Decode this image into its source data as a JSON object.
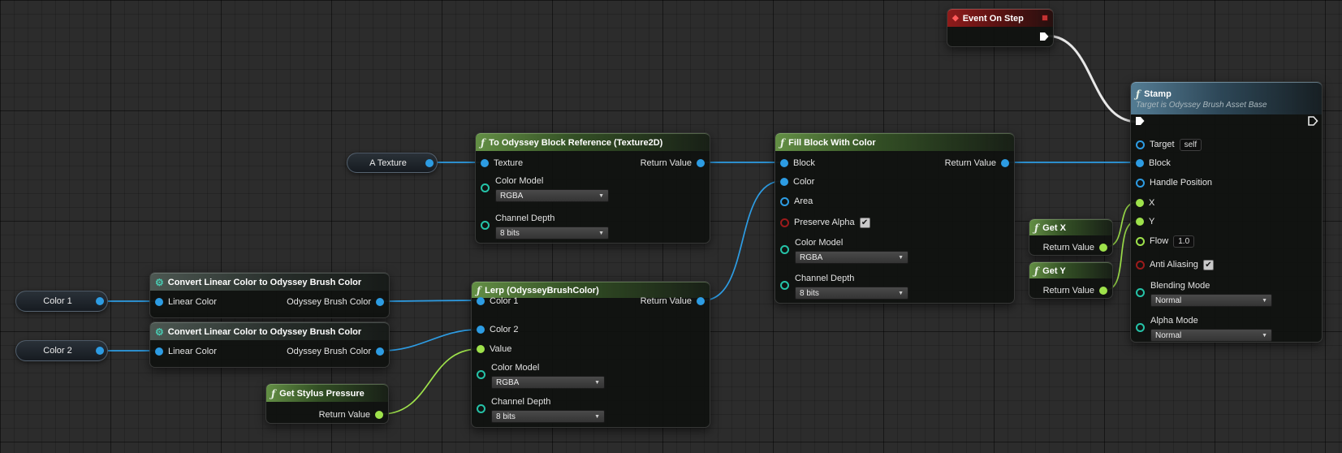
{
  "icons": {
    "fn": "ƒ",
    "gear": "⚙",
    "diamond": "◆",
    "check": "✔",
    "arrow": "▼"
  },
  "colors": {
    "wire_exec": "#e8e8e8",
    "wire_object": "#2d9ce3",
    "wire_float": "#9ee24b",
    "pin_object": "#2d9ce3",
    "pin_float": "#9ee24b",
    "pin_bool": "#9b1b1b",
    "pin_enum": "#25c3a8",
    "header_function": "#68963f",
    "header_event": "#961c1c",
    "header_target": "#58829b"
  },
  "nodes": {
    "event_on_step": {
      "title": "Event On Step"
    },
    "stamp": {
      "title": "Stamp",
      "subtitle": "Target is Odyssey Brush Asset Base",
      "pins": {
        "target": "Target",
        "block": "Block",
        "handle_position": "Handle Position",
        "x": "X",
        "y": "Y",
        "flow": "Flow",
        "anti_aliasing": "Anti Aliasing",
        "blending_mode": "Blending Mode",
        "alpha_mode": "Alpha Mode"
      },
      "values": {
        "target": "self",
        "flow": "1.0",
        "blending_mode": "Normal",
        "alpha_mode": "Normal"
      }
    },
    "to_block_reference": {
      "title": "To Odyssey Block Reference (Texture2D)",
      "pins": {
        "texture": "Texture",
        "return_value": "Return Value",
        "color_model": "Color Model",
        "channel_depth": "Channel Depth"
      },
      "values": {
        "color_model": "RGBA",
        "channel_depth": "8 bits"
      }
    },
    "fill_block_with_color": {
      "title": "Fill Block With Color",
      "pins": {
        "block": "Block",
        "return_value": "Return Value",
        "color": "Color",
        "area": "Area",
        "preserve_alpha": "Preserve Alpha",
        "color_model": "Color Model",
        "channel_depth": "Channel Depth"
      },
      "values": {
        "color_model": "RGBA",
        "channel_depth": "8 bits"
      }
    },
    "get_x": {
      "title": "Get X",
      "pins": {
        "return_value": "Return Value"
      }
    },
    "get_y": {
      "title": "Get Y",
      "pins": {
        "return_value": "Return Value"
      }
    },
    "a_texture": {
      "title": "A Texture"
    },
    "convert_1": {
      "title": "Convert Linear Color to Odyssey Brush Color",
      "pins": {
        "input": "Linear Color",
        "output": "Odyssey Brush Color"
      }
    },
    "convert_2": {
      "title": "Convert Linear Color to Odyssey Brush Color",
      "pins": {
        "input": "Linear Color",
        "output": "Odyssey Brush Color"
      }
    },
    "color_1": {
      "title": "Color 1"
    },
    "color_2": {
      "title": "Color 2"
    },
    "lerp": {
      "title": "Lerp (OdysseyBrushColor)",
      "pins": {
        "color_1": "Color 1",
        "color_2": "Color 2",
        "value": "Value",
        "return_value": "Return Value",
        "color_model": "Color Model",
        "channel_depth": "Channel Depth"
      },
      "values": {
        "color_model": "RGBA",
        "channel_depth": "8 bits"
      }
    },
    "get_stylus_pressure": {
      "title": "Get Stylus Pressure",
      "pins": {
        "return_value": "Return Value"
      }
    }
  }
}
